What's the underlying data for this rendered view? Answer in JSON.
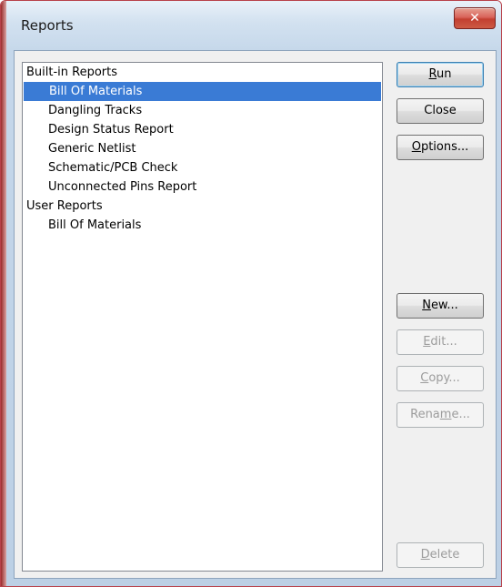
{
  "window": {
    "title": "Reports",
    "close_glyph": "✕"
  },
  "report_list": {
    "groups": [
      {
        "label": "Built-in Reports",
        "items": [
          {
            "label": "Bill Of Materials",
            "selected": true
          },
          {
            "label": "Dangling Tracks"
          },
          {
            "label": "Design Status Report"
          },
          {
            "label": "Generic Netlist"
          },
          {
            "label": "Schematic/PCB Check"
          },
          {
            "label": "Unconnected Pins Report"
          }
        ]
      },
      {
        "label": "User Reports",
        "items": [
          {
            "label": "Bill Of Materials"
          }
        ]
      }
    ]
  },
  "buttons": {
    "run": {
      "label": "Run",
      "mnemonic": "R"
    },
    "close": {
      "label": "Close",
      "mnemonic": ""
    },
    "options": {
      "label": "Options...",
      "mnemonic": "O"
    },
    "new": {
      "label": "New...",
      "mnemonic": "N"
    },
    "edit": {
      "label": "Edit...",
      "mnemonic": "E"
    },
    "copy": {
      "label": "Copy...",
      "mnemonic": "C"
    },
    "rename": {
      "label": "Rename...",
      "mnemonic": "m"
    },
    "delete": {
      "label": "Delete",
      "mnemonic": "D"
    }
  },
  "colors": {
    "selection": "#3a7bd5",
    "title_close": "#c33f30",
    "disabled_text": "#9c9c9c"
  }
}
